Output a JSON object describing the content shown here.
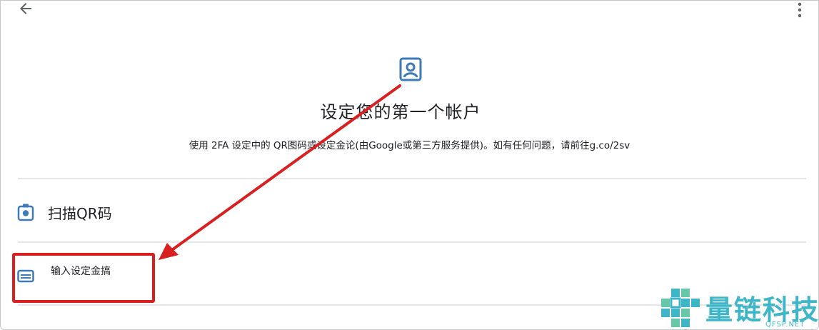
{
  "header": {
    "back_icon": "arrow-left-icon",
    "menu_icon": "more-vert-icon"
  },
  "main": {
    "icon": "account-box-icon",
    "title": "设定您的第一个帐户",
    "description": "使用 2FA 设定中的 QR图码或设定金论(由Google或第三方服务提供)。如有任何问题，请前往g.co/2sv"
  },
  "options": [
    {
      "label": "扫描QR码",
      "icon": "camera-icon"
    },
    {
      "label": "输入设定金搞",
      "icon": "keyboard-icon"
    }
  ],
  "annotation": {
    "color": "#d92020"
  },
  "watermark": {
    "name": "量链科技",
    "domain": "QFSP.NET",
    "color": "#3fb5c8"
  },
  "colors": {
    "accent": "#3d7bb8",
    "text": "#202124"
  }
}
